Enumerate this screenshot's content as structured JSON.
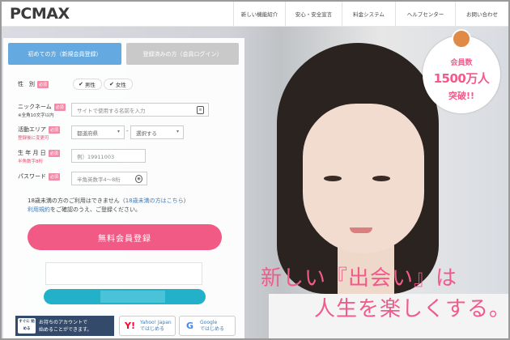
{
  "header": {
    "logo": "PCMAX",
    "nav": [
      {
        "label": "新しい機能紹介"
      },
      {
        "label": "安心・安全宣言"
      },
      {
        "label": "料金システム"
      },
      {
        "label": "ヘルプセンター"
      },
      {
        "label": "お問い合わせ"
      }
    ]
  },
  "tabs": {
    "new_label": "初めての方（新規会員登録）",
    "registered_label": "登録済みの方（会員ログイン）"
  },
  "form": {
    "gender": {
      "label": "性　別",
      "required": "必須",
      "options": [
        "男性",
        "女性"
      ]
    },
    "nickname": {
      "label": "ニックネーム",
      "required": "必須",
      "sub": "※全角10文字以内",
      "placeholder": "サイトで使用する名前を入力"
    },
    "area": {
      "label": "活動エリア",
      "required": "必須",
      "sub": "登録後に変更可",
      "prefecture": "都道府県",
      "city": "選択する"
    },
    "birthday": {
      "label": "生 年 月 日",
      "required": "必須",
      "sub": "半角数字8桁",
      "placeholder": "例）19911003"
    },
    "password": {
      "label": "パスワード",
      "required": "必須",
      "placeholder": "半角英数字4～8桁"
    },
    "notice_line1": "18歳未満の方のご利用はできません（",
    "notice_link1": "18歳未満の方はこちら",
    "notice_end1": "）",
    "notice_link2": "利用規約",
    "notice_line2": "をご確認のうえ、ご登録ください。",
    "submit": "無料会員登録"
  },
  "social": {
    "note_icon": "すぐに\n始める",
    "note_line1": "お持ちのアカウントで",
    "note_line2": "始めることができます。",
    "yahoo": {
      "line1": "Yahoo! Japan",
      "line2": "ではじめる"
    },
    "google": {
      "line1": "Google",
      "line2": "ではじめる"
    }
  },
  "badge": {
    "line1": "会員数",
    "line2": "1500万人",
    "line3": "突破!!"
  },
  "catchcopy": {
    "line1": "新しい『出会い』は",
    "line2": "人生を楽しくする。"
  },
  "colors": {
    "accent_pink": "#f25a86",
    "tab_blue": "#64a9df",
    "teal": "#23b0c9",
    "navy": "#334a6a"
  }
}
